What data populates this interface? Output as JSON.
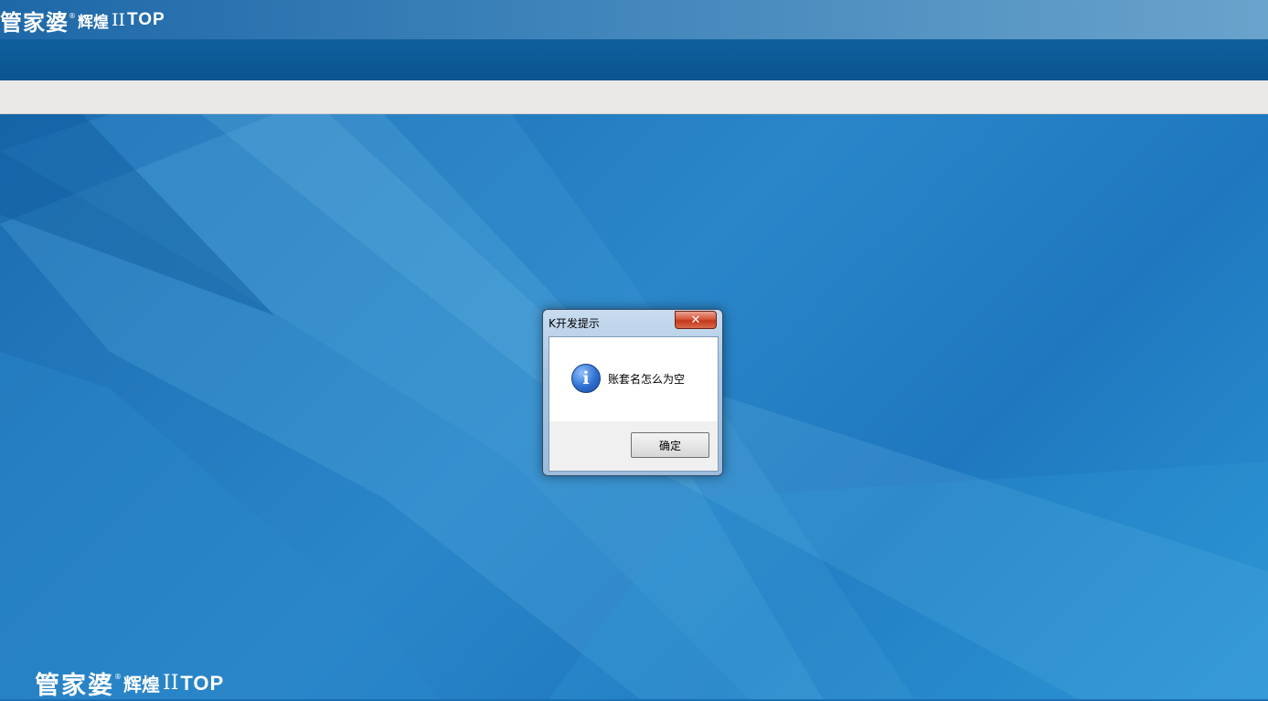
{
  "header": {
    "logo_main": "管家婆",
    "logo_sub": "辉煌",
    "logo_roman": "II",
    "logo_top": "TOP",
    "reg_mark": "®"
  },
  "footer_logo": {
    "main": "管家婆",
    "sub": "辉煌",
    "roman": "II",
    "top": "TOP",
    "reg_mark": "®"
  },
  "dialog": {
    "title": "K开发提示",
    "close_glyph": "✕",
    "icon": "info-icon",
    "icon_glyph": "i",
    "message": "账套名怎么为空",
    "ok_label": "确定"
  },
  "colors": {
    "desktop_blue": "#1a6fb3",
    "menubar_blue": "#0a558f",
    "toolbar_gray": "#ebe8e8"
  }
}
